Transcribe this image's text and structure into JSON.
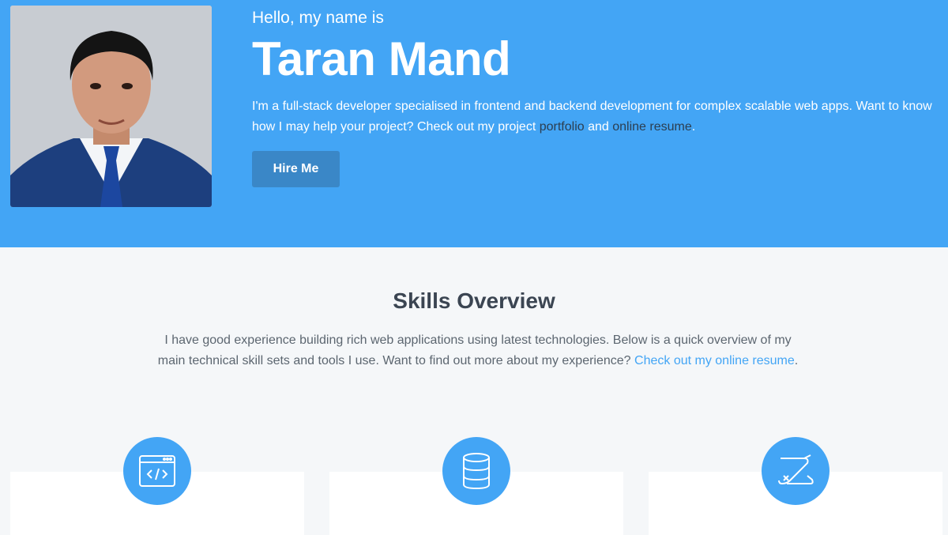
{
  "hero": {
    "greeting": "Hello, my name is",
    "name": "Taran Mand",
    "intro_text": "I'm a full-stack developer specialised in frontend and backend development for complex scalable web apps. Want to know how I may help your project? Check out my project ",
    "portfolio_link": "portfolio",
    "and_text": " and ",
    "resume_link": "online resume",
    "period": ".",
    "hire_button": "Hire Me"
  },
  "skills": {
    "title": "Skills Overview",
    "description": "I have good experience building rich web applications using latest technologies. Below is a quick overview of my main technical skill sets and tools I use. Want to find out more about my experience? ",
    "resume_link": "Check out my online resume",
    "period": ".",
    "cards": [
      {
        "icon": "code-window-icon"
      },
      {
        "icon": "database-icon"
      },
      {
        "icon": "swiss-knife-icon"
      }
    ]
  },
  "colors": {
    "primary": "#43a5f5",
    "button": "#3a87c7",
    "background": "#f5f7f9"
  }
}
